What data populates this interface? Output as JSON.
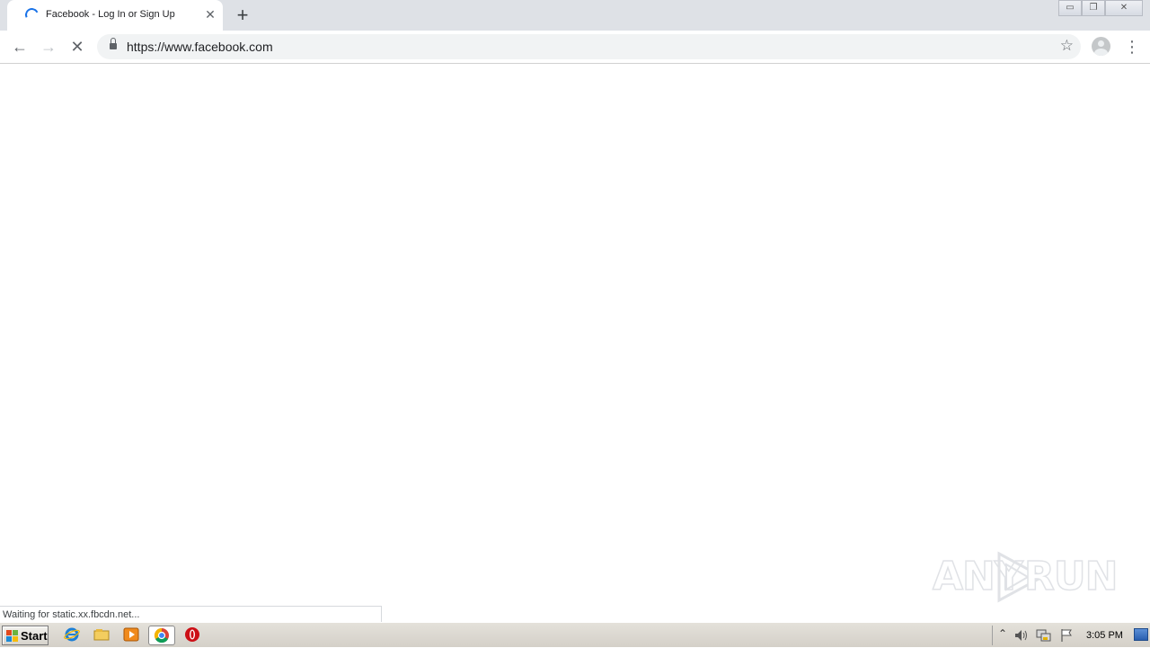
{
  "tab": {
    "title": "Facebook - Log In or Sign Up",
    "close_glyph": "✕",
    "new_tab_glyph": "+"
  },
  "window_controls": {
    "minimize": "▭",
    "restore": "❐",
    "close": "✕"
  },
  "toolbar": {
    "back_glyph": "←",
    "forward_glyph": "→",
    "stop_glyph": "✕",
    "url": "https://www.facebook.com",
    "bookmark_glyph": "☆",
    "menu_glyph": "⋮"
  },
  "status_text": "Waiting for static.xx.fbcdn.net...",
  "watermark": {
    "left": "ANY",
    "right": "RUN"
  },
  "taskbar": {
    "start_label": "Start",
    "icons": [
      "internet-explorer-icon",
      "file-explorer-icon",
      "media-player-icon",
      "chrome-icon",
      "opera-icon"
    ],
    "tray_up_glyph": "⌃",
    "clock": "3:05 PM"
  },
  "colors": {
    "tab_strip": "#dee1e6",
    "spinner": "#1a73e8",
    "omnibox": "#f1f3f4",
    "taskbar": "#d4d0c8"
  }
}
